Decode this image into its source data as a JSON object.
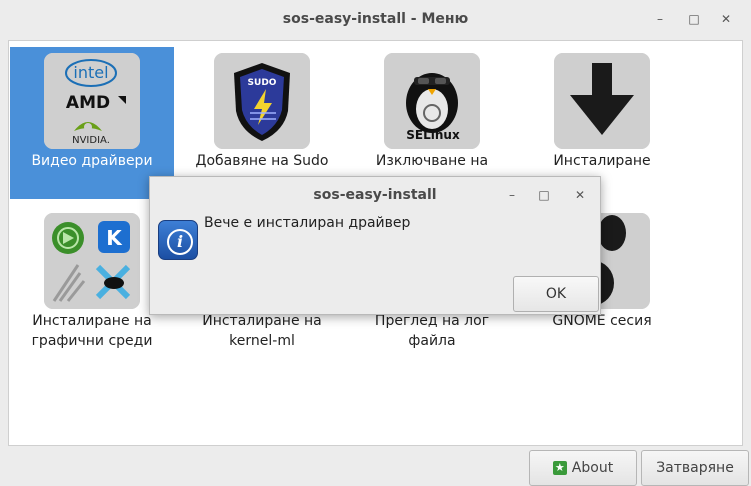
{
  "window": {
    "title": "sos-easy-install - Меню"
  },
  "items": [
    {
      "label": "Видео драйвери",
      "selected": true,
      "icon": "intel-amd-nvidia-icon",
      "logos": [
        "intel",
        "AMD",
        "NVIDIA."
      ]
    },
    {
      "label": "Добавяне на Sudo",
      "icon": "sudo-shield-icon",
      "logos": [
        "SUDO"
      ]
    },
    {
      "label": "Изключване на",
      "icon": "selinux-penguin-icon",
      "logos": [
        "SELinux"
      ]
    },
    {
      "label": "Инсталиране",
      "icon": "download-arrow-icon"
    },
    {
      "label": "Инсталиране на графични среди",
      "icon": "desktop-environments-icon"
    },
    {
      "label": "Инсталиране на kernel-ml",
      "icon": "kernel-icon"
    },
    {
      "label": "Преглед на лог файла",
      "icon": "log-icon"
    },
    {
      "label": "GNOME сесия",
      "icon": "gnome-foot-icon"
    }
  ],
  "footer": {
    "about_label": "About",
    "close_label": "Затваряне"
  },
  "dialog": {
    "title": "sos-easy-install",
    "message": "Вече е инсталиран драйвер",
    "ok_label": "OK"
  },
  "colors": {
    "selection": "#4a90d9",
    "background": "#ececec",
    "content": "#ffffff"
  }
}
